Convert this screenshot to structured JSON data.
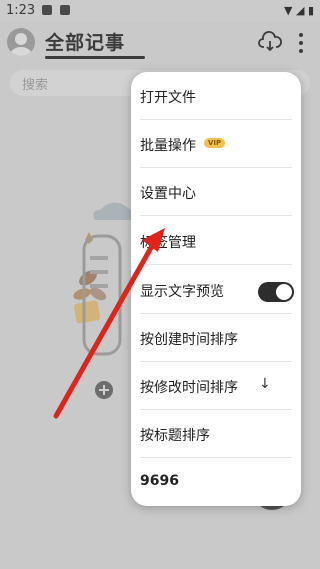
{
  "status": {
    "time": "1:23"
  },
  "header": {
    "title": "全部记事"
  },
  "search": {
    "placeholder": "搜索"
  },
  "empty": {
    "line1": "",
    "line2": ""
  },
  "menu": {
    "items": [
      {
        "label": "打开文件"
      },
      {
        "label": "批量操作",
        "badge": "VIP"
      },
      {
        "label": "设置中心"
      },
      {
        "label": "标签管理"
      },
      {
        "label": "显示文字预览"
      },
      {
        "label": "按创建时间排序"
      },
      {
        "label": "按修改时间排序",
        "suffix": "↓"
      },
      {
        "label": "按标题排序"
      },
      {
        "label": "9696"
      }
    ],
    "preview_toggle": "on"
  },
  "colors": {
    "annotation_arrow": "#e0231b",
    "toggle_on": "#2d2d2d",
    "vip_badge": "#f2c14e"
  },
  "icons": [
    "image-icon",
    "notification-icon",
    "wifi-icon",
    "signal-icon",
    "battery-icon",
    "avatar-icon",
    "cloud-download-icon",
    "more-vert-icon"
  ]
}
